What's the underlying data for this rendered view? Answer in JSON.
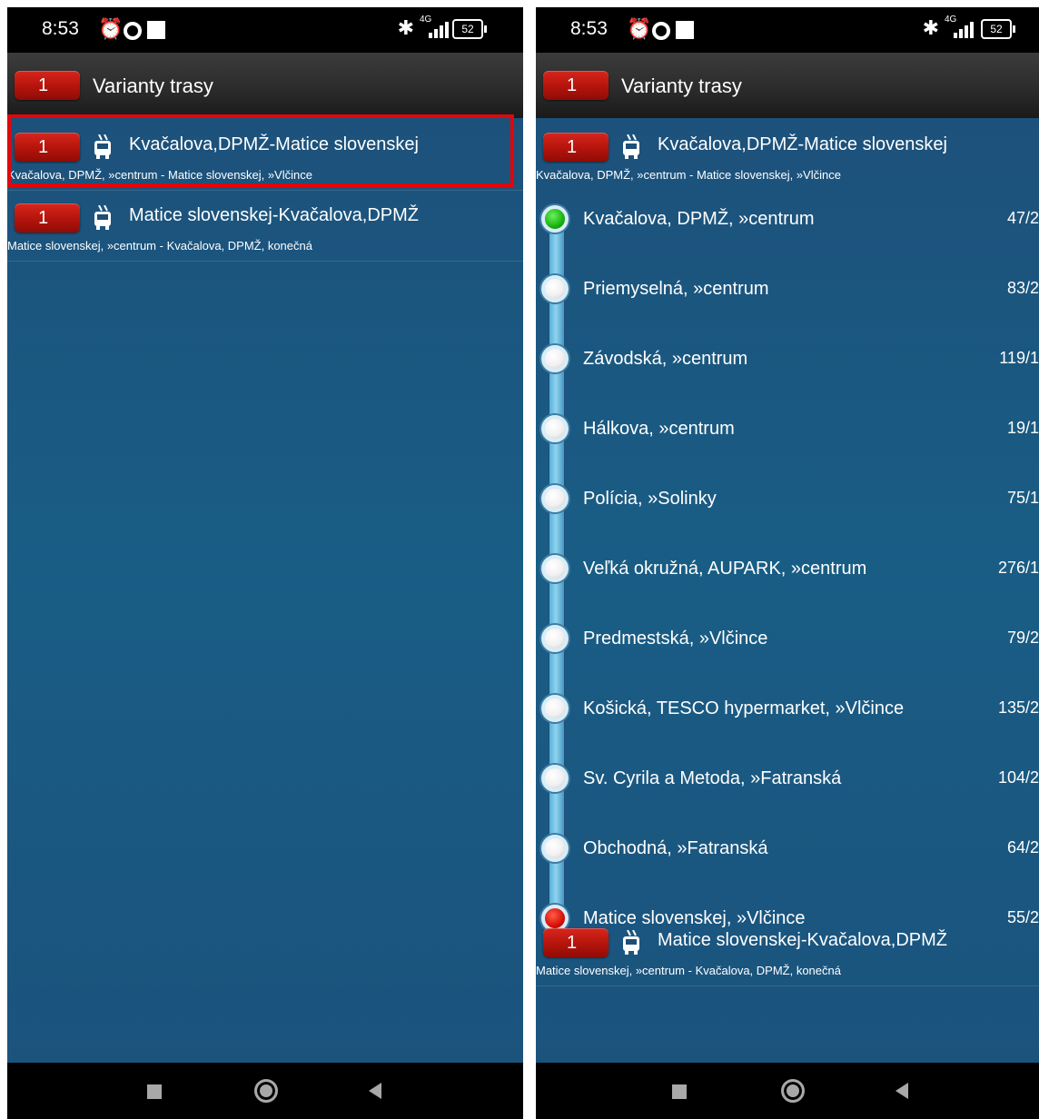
{
  "status": {
    "time": "8:53",
    "battery": "52",
    "network": "4G"
  },
  "header": {
    "badge": "1",
    "title": "Varianty trasy"
  },
  "routes": [
    {
      "badge": "1",
      "title": "Kvačalova,DPMŽ-Matice slovenskej",
      "subtitle": "Kvačalova, DPMŽ, »centrum - Matice slovenskej, »Vlčince",
      "icon": "trolleybus-icon"
    },
    {
      "badge": "1",
      "title": "Matice slovenskej-Kvačalova,DPMŽ",
      "subtitle": "Matice slovenskej, »centrum - Kvačalova, DPMŽ, konečná",
      "icon": "trolleybus-icon"
    }
  ],
  "stops": [
    {
      "name": "Kvačalova, DPMŽ, »centrum",
      "code": "47/2"
    },
    {
      "name": "Priemyselná, »centrum",
      "code": "83/2"
    },
    {
      "name": "Závodská, »centrum",
      "code": "119/1"
    },
    {
      "name": "Hálkova, »centrum",
      "code": "19/1"
    },
    {
      "name": "Polícia, »Solinky",
      "code": "75/1"
    },
    {
      "name": "Veľká okružná, AUPARK, »centrum",
      "code": "276/1"
    },
    {
      "name": "Predmestská, »Vlčince",
      "code": "79/2"
    },
    {
      "name": "Košická, TESCO hypermarket, »Vlčince",
      "code": "135/2"
    },
    {
      "name": "Sv. Cyrila a Metoda, »Fatranská",
      "code": "104/2"
    },
    {
      "name": "Obchodná, »Fatranská",
      "code": "64/2"
    },
    {
      "name": "Matice slovenskej, »Vlčince",
      "code": "55/2"
    }
  ],
  "colors": {
    "accent_red": "#d7261c",
    "background_blue": "#195d85",
    "highlight_border": "#e3050a"
  }
}
